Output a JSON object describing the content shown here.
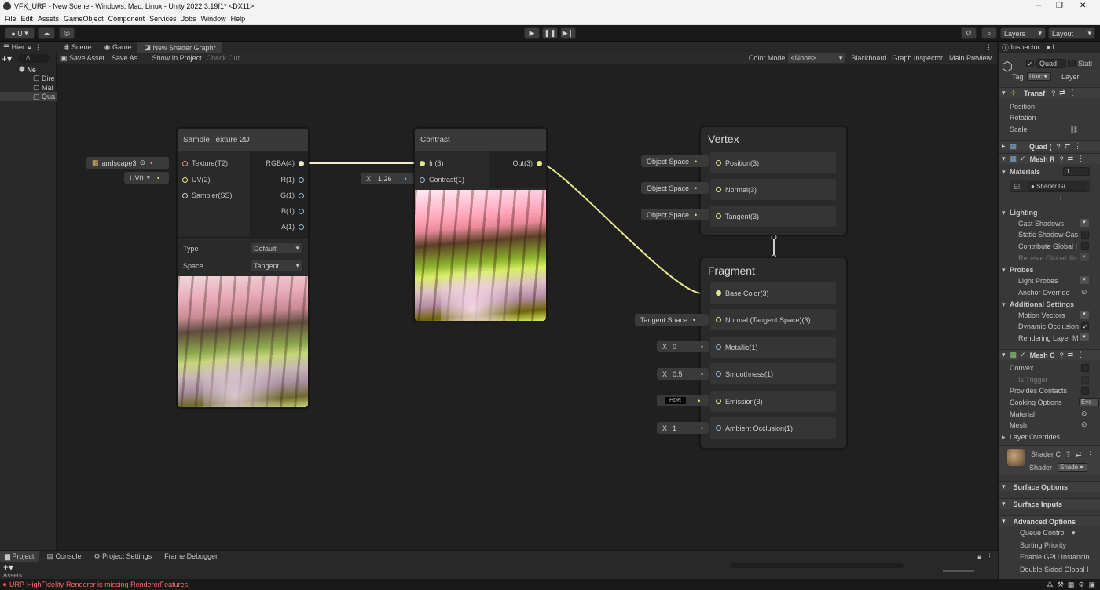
{
  "window": {
    "title": "VFX_URP - New Scene - Windows, Mac, Linux - Unity 2022.3.19f1* <DX11>",
    "minimize": "─",
    "maximize": "❐",
    "close": "✕"
  },
  "menu": [
    "File",
    "Edit",
    "Assets",
    "GameObject",
    "Component",
    "Services",
    "Jobs",
    "Window",
    "Help"
  ],
  "toolbar": {
    "account": "U",
    "layers": "Layers",
    "layout": "Layout"
  },
  "hierarchy": {
    "tab": "Hier",
    "search_placeholder": "A",
    "scene": "Ne",
    "items": [
      "Dire",
      "Mai",
      "Qua"
    ]
  },
  "graph": {
    "tabs": [
      "Scene",
      "Game",
      "New Shader Graph*"
    ],
    "toolbar": {
      "save_asset": "Save Asset",
      "save_as": "Save As...",
      "show_in_project": "Show In Project",
      "check_out": "Check Out",
      "color_mode_label": "Color Mode",
      "color_mode_value": "<None>",
      "blackboard": "Blackboard",
      "graph_inspector": "Graph Inspector",
      "main_preview": "Main Preview"
    },
    "sample_texture": {
      "title": "Sample Texture 2D",
      "inputs": [
        "Texture(T2)",
        "UV(2)",
        "Sampler(SS)"
      ],
      "outputs": [
        "RGBA(4)",
        "R(1)",
        "G(1)",
        "B(1)",
        "A(1)"
      ],
      "type_label": "Type",
      "type_value": "Default",
      "space_label": "Space",
      "space_value": "Tangent",
      "texture_input": "landscape3",
      "uv_input": "UV0"
    },
    "contrast": {
      "title": "Contrast",
      "inputs": [
        "In(3)",
        "Contrast(1)"
      ],
      "output": "Out(3)",
      "contrast_x_label": "X",
      "contrast_value": "1.26"
    },
    "vertex": {
      "title": "Vertex",
      "ports": [
        {
          "label": "Position(3)",
          "input": "Object Space"
        },
        {
          "label": "Normal(3)",
          "input": "Object Space"
        },
        {
          "label": "Tangent(3)",
          "input": "Object Space"
        }
      ]
    },
    "fragment": {
      "title": "Fragment",
      "base_color": "Base Color(3)",
      "normal": "Normal (Tangent Space)(3)",
      "normal_input": "Tangent Space",
      "metallic": "Metallic(1)",
      "metallic_value": "0",
      "smoothness": "Smoothness(1)",
      "smoothness_value": "0.5",
      "emission": "Emission(3)",
      "emission_input": "HDR",
      "ao": "Ambient Occlusion(1)",
      "ao_value": "1",
      "x_label": "X"
    }
  },
  "inspector": {
    "tabs": [
      "Inspector",
      "L"
    ],
    "object_name": "Quad",
    "static_label": "Stati",
    "tag_label": "Tag",
    "tag_value": "Untc",
    "layer_label": "Layer",
    "transform": {
      "title": "Transf",
      "position": "Position",
      "rotation": "Rotation",
      "scale": "Scale"
    },
    "quad_component": "Quad (",
    "mesh_renderer": "Mesh R",
    "materials_label": "Materials",
    "materials_count": "1",
    "material_element": "El",
    "material_value": "Shader Gr",
    "lighting": {
      "title": "Lighting",
      "items": [
        "Cast Shadows",
        "Static Shadow Cas",
        "Contribute Global I",
        "Receive Global Illu"
      ]
    },
    "probes": {
      "title": "Probes",
      "items": [
        "Light Probes",
        "Anchor Override"
      ]
    },
    "additional": {
      "title": "Additional Settings",
      "items": [
        "Motion Vectors",
        "Dynamic Occlusion",
        "Rendering Layer M"
      ]
    },
    "mesh_collider": {
      "title": "Mesh C",
      "items": [
        "Convex",
        "Is Trigger",
        "Provides Contacts",
        "Cooking Options",
        "Material",
        "Mesh"
      ],
      "cooking_value": "Eve",
      "layer_overrides": "Layer Overrides"
    },
    "shader_section": {
      "name": "Shader C",
      "shader_label": "Shader",
      "shader_value": "Shade"
    },
    "surface_options": "Surface Options",
    "surface_inputs": "Surface Inputs",
    "advanced": {
      "title": "Advanced Options",
      "items": [
        "Queue Control",
        "Sorting Priority",
        "Enable GPU Instancin",
        "Double Sided Global I"
      ]
    }
  },
  "bottom": {
    "tabs": [
      "Project",
      "Console",
      "Project Settings",
      "Frame Debugger"
    ],
    "assets_label": "Assets"
  },
  "status": {
    "error": "URP-HighFidelity-Renderer is missing RendererFeatures"
  },
  "colors": {
    "accent_blue": "#3a79bb",
    "vector_port": "#e5e58a",
    "float_port": "#8fb9d9",
    "texture_port": "#ff8b8b",
    "error": "#ff4a4a"
  }
}
